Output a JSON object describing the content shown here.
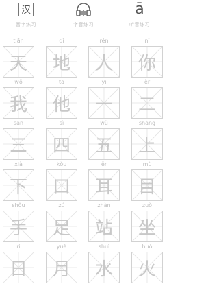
{
  "toolbar": {
    "items": [
      {
        "label": "音字练习",
        "glyph": "汉",
        "icon": "hanzi-box-icon"
      },
      {
        "label": "字音练习",
        "icon": "headphones-icon"
      },
      {
        "label": "听音练习",
        "glyph": "ā",
        "icon": "tone-letter-icon"
      }
    ]
  },
  "characters": [
    {
      "pinyin": "tiān",
      "hanzi": "天"
    },
    {
      "pinyin": "dì",
      "hanzi": "地"
    },
    {
      "pinyin": "rén",
      "hanzi": "人"
    },
    {
      "pinyin": "nǐ",
      "hanzi": "你"
    },
    {
      "pinyin": "wǒ",
      "hanzi": "我"
    },
    {
      "pinyin": "tā",
      "hanzi": "他"
    },
    {
      "pinyin": "yī",
      "hanzi": "一"
    },
    {
      "pinyin": "èr",
      "hanzi": "二"
    },
    {
      "pinyin": "sān",
      "hanzi": "三"
    },
    {
      "pinyin": "sì",
      "hanzi": "四"
    },
    {
      "pinyin": "wǔ",
      "hanzi": "五"
    },
    {
      "pinyin": "shàng",
      "hanzi": "上"
    },
    {
      "pinyin": "xià",
      "hanzi": "下"
    },
    {
      "pinyin": "kǒu",
      "hanzi": "口"
    },
    {
      "pinyin": "ěr",
      "hanzi": "耳"
    },
    {
      "pinyin": "mù",
      "hanzi": "目"
    },
    {
      "pinyin": "shǒu",
      "hanzi": "手"
    },
    {
      "pinyin": "zú",
      "hanzi": "足"
    },
    {
      "pinyin": "zhàn",
      "hanzi": "站"
    },
    {
      "pinyin": "zuò",
      "hanzi": "坐"
    },
    {
      "pinyin": "rì",
      "hanzi": "日"
    },
    {
      "pinyin": "yuè",
      "hanzi": "月"
    },
    {
      "pinyin": "shuǐ",
      "hanzi": "水"
    },
    {
      "pinyin": "huǒ",
      "hanzi": "火"
    }
  ]
}
